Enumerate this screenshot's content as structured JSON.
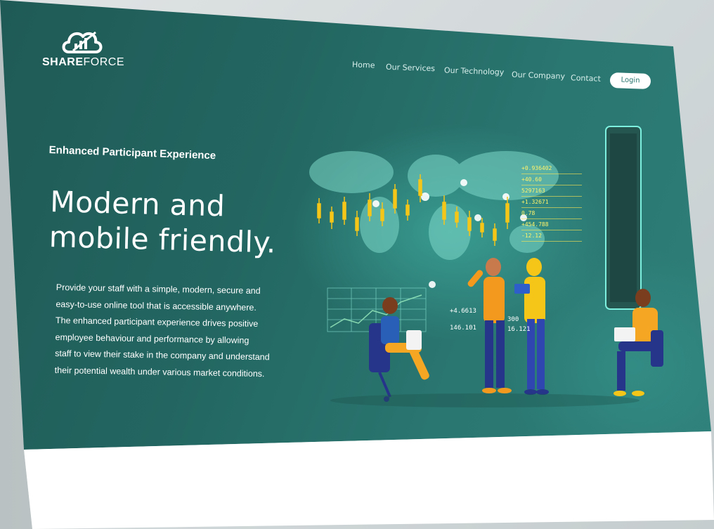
{
  "brand": {
    "name_bold": "SHARE",
    "name_light": "FORCE"
  },
  "nav": {
    "items": [
      "Home",
      "Our Services",
      "Our Technology",
      "Our Company",
      "Contact"
    ],
    "login_label": "Login"
  },
  "hero": {
    "eyebrow": "Enhanced Participant Experience",
    "headline_line1": "Modern and",
    "headline_line2": "mobile friendly.",
    "body": [
      "Provide your staff with a simple, modern, secure and",
      "easy-to-use online tool that is accessible anywhere.",
      "The enhanced participant experience drives positive",
      "employee behaviour and performance by allowing",
      "staff to view their stake in the company and understand",
      "their potential wealth under various market conditions."
    ]
  },
  "illustration": {
    "stock_values": [
      "+0.936402",
      "+40.60",
      "5297163",
      "+1.32671",
      "0.78",
      "+454.788",
      "-12.12"
    ],
    "tickers": [
      "+4.6613",
      "146.101",
      "300",
      "16.121"
    ],
    "colors": {
      "accent_yellow": "#f5c518",
      "orange": "#f39a1e",
      "navy": "#263a8c",
      "teal_bg": "#2a7670"
    }
  }
}
